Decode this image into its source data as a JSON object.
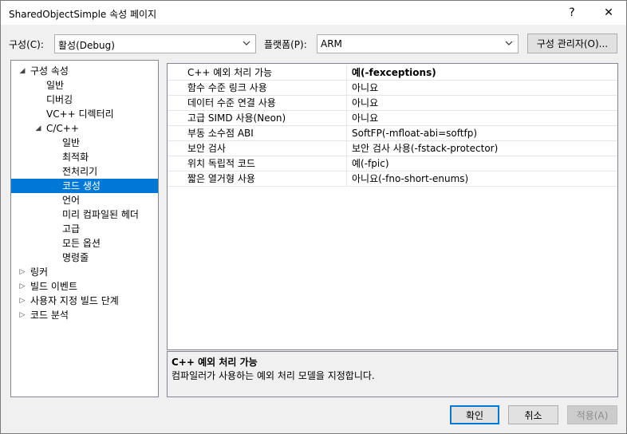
{
  "window": {
    "title": "SharedObjectSimple 속성 페이지",
    "help_label": "?",
    "close_label": "✕"
  },
  "config": {
    "label": "구성(C):",
    "value": "활성(Debug)",
    "platform_label": "플랫폼(P):",
    "platform_value": "ARM",
    "manager_button": "구성 관리자(O)..."
  },
  "tree": {
    "items": [
      {
        "label": "구성 속성",
        "arrow": "◢"
      },
      {
        "label": "일반"
      },
      {
        "label": "디버깅"
      },
      {
        "label": "VC++ 디렉터리"
      },
      {
        "label": "C/C++",
        "arrow": "◢"
      },
      {
        "label": "일반"
      },
      {
        "label": "최적화"
      },
      {
        "label": "전처리기"
      },
      {
        "label": "코드 생성"
      },
      {
        "label": "언어"
      },
      {
        "label": "미리 컴파일된 헤더"
      },
      {
        "label": "고급"
      },
      {
        "label": "모든 옵션"
      },
      {
        "label": "명령줄"
      },
      {
        "label": "링커",
        "arrow": "▷"
      },
      {
        "label": "빌드 이벤트",
        "arrow": "▷"
      },
      {
        "label": "사용자 지정 빌드 단계",
        "arrow": "▷"
      },
      {
        "label": "코드 분석",
        "arrow": "▷"
      }
    ],
    "selected_index": 8
  },
  "properties": [
    {
      "name": "C++ 예외 처리 가능",
      "value": "예(-fexceptions)"
    },
    {
      "name": "함수 수준 링크 사용",
      "value": "아니요"
    },
    {
      "name": "데이터 수준 연결 사용",
      "value": "아니요"
    },
    {
      "name": "고급 SIMD 사용(Neon)",
      "value": "아니요"
    },
    {
      "name": "부동 소수점 ABI",
      "value": "SoftFP(-mfloat-abi=softfp)"
    },
    {
      "name": "보안 검사",
      "value": "보안 검사 사용(-fstack-protector)"
    },
    {
      "name": "위치 독립적 코드",
      "value": "예(-fpic)"
    },
    {
      "name": "짧은 열거형 사용",
      "value": "아니요(-fno-short-enums)"
    }
  ],
  "description": {
    "title": "C++ 예외 처리 가능",
    "text": "컴파일러가 사용하는 예외 처리 모델을 지정합니다."
  },
  "buttons": {
    "ok": "확인",
    "cancel": "취소",
    "apply": "적용(A)"
  }
}
